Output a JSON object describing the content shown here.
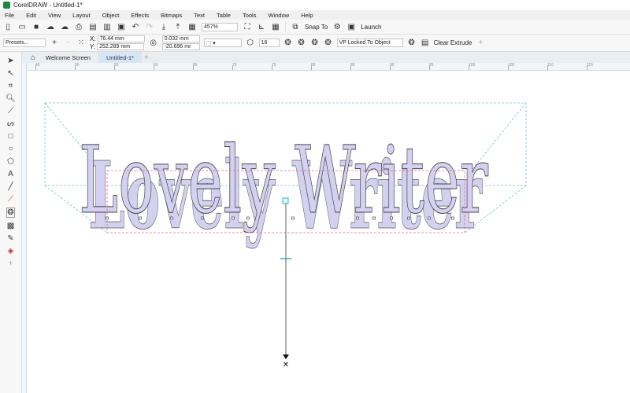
{
  "app": {
    "title": "CorelDRAW - Untitled-1*"
  },
  "menu": [
    "File",
    "Edit",
    "View",
    "Layout",
    "Object",
    "Effects",
    "Bitmaps",
    "Text",
    "Table",
    "Tools",
    "Window",
    "Help"
  ],
  "toolbar": {
    "zoom": "457%",
    "snap_to": "Snap To",
    "launch": "Launch"
  },
  "propbar": {
    "presets": "Presets...",
    "x": "76.44 mm",
    "y": "252.289 mm",
    "vp_x": "0.032 mm",
    "vp_y": "-20.696 mr",
    "depth": "16",
    "vp_mode": "VP Locked To Object",
    "clear_extrude": "Clear Extrude",
    "x_label": "X:",
    "y_label": "Y:"
  },
  "tabs": {
    "welcome": "Welcome Screen",
    "doc": "Untitled-1*"
  },
  "ruler": [
    "45",
    "50",
    "55",
    "60",
    "65",
    "70",
    "75",
    "80",
    "85",
    "90",
    "95",
    "100",
    "105",
    "110",
    "115"
  ],
  "canvas": {
    "text": "Lovely Writer",
    "fill": "#d4d0f0",
    "guide": "#7fbfcf",
    "bbox": "#d87090"
  }
}
